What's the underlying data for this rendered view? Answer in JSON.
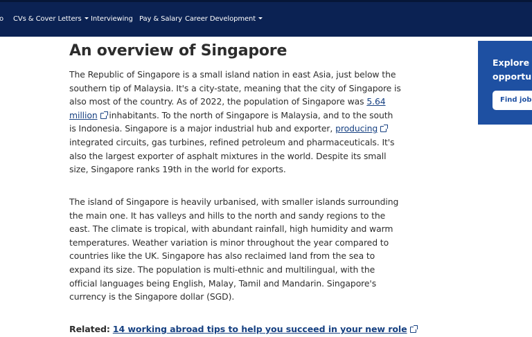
{
  "nav": {
    "items": [
      {
        "label": "o",
        "dropdown": false
      },
      {
        "label": "CVs & Cover Letters",
        "dropdown": true
      },
      {
        "label": "Interviewing",
        "dropdown": false
      },
      {
        "label": "Pay & Salary",
        "dropdown": false
      },
      {
        "label": "Career Development",
        "dropdown": true
      }
    ],
    "background": "#0b2253"
  },
  "article": {
    "heading": "An overview of Singapore",
    "p1": {
      "t1": "The Republic of Singapore is a small island nation in east Asia, just below the southern tip of Malaysia. It's a city-state, meaning that the city of Singapore is also most of the country. As of 2022, the population of Singapore was ",
      "link1": "5.64 million",
      "t2": " inhabitants. To the north of Singapore is Malaysia, and to the south is Indonesia. Singapore is a major industrial hub and exporter, ",
      "link2": "producing",
      "t3": " integrated circuits, gas turbines, refined petroleum and pharmaceuticals. It's also the largest exporter of asphalt mixtures in the world. Despite its small size, Singapore ranks 19th in the world for exports."
    },
    "p2": "The island of Singapore is heavily urbanised, with smaller islands surrounding the main one. It has valleys and hills to the north and sandy regions to the east. The climate is tropical, with abundant rainfall, high humidity and warm temperatures. Weather variation is minor throughout the year compared to countries like the UK. Singapore has also reclaimed land from the sea to expand its size. The population is multi-ethnic and multilingual, with the official languages being English, Malay, Tamil and Mandarin. Singapore's currency is the Singapore dollar (SGD).",
    "related": {
      "label": "Related:",
      "link": "14 working abroad tips to help you succeed in your new role"
    },
    "link_color": "#164081"
  },
  "promo": {
    "text": "Explore y\nopportur",
    "button": "Find jobs",
    "background": "#1e50a2"
  }
}
